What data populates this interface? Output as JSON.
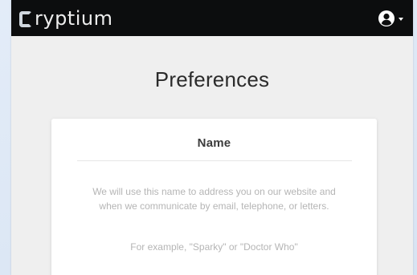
{
  "brand": {
    "name": "ryptium",
    "logo": "cryptium-c-logo"
  },
  "header": {
    "account_icon": "user-circle-icon",
    "menu_icon": "caret-down-icon"
  },
  "page": {
    "title": "Preferences"
  },
  "card": {
    "heading": "Name",
    "description": "We will use this name to address you on our website and when we communicate by email, telephone, or letters.",
    "example": "For example, \"Sparky\" or \"Doctor Who\""
  },
  "colors": {
    "topbar": "#0c0d0e",
    "page_background": "#efefef",
    "card_background": "#ffffff",
    "muted_text": "#b5b5b5"
  }
}
